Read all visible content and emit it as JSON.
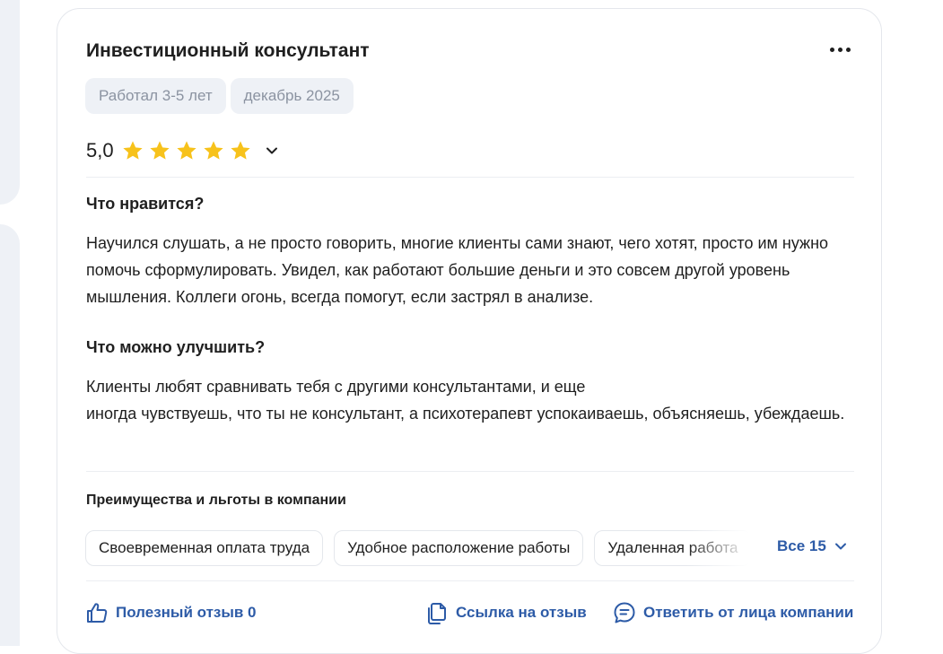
{
  "review": {
    "title": "Инвестиционный консультант",
    "tags": [
      "Работал 3-5 лет",
      "декабрь 2025"
    ],
    "rating": "5,0",
    "stars_filled": 5,
    "stars_total": 5,
    "star_color": "#f7c21b",
    "likes_title": "Что нравится?",
    "likes_text": "Научился слушать, а не просто говорить, многие клиенты сами знают, чего хотят, просто им нужно помочь сформулировать. Увидел, как работают большие деньги и это совсем другой уровень мышления. Коллеги огонь, всегда помогут, если застрял в анализе.",
    "improve_title": "Что можно улучшить?",
    "improve_text": "Клиенты любят сравнивать тебя с другими консультантами, и еще\nиногда чувствуешь, что ты не консультант, а психотерапевт успокаиваешь, объясняешь, убеждаешь."
  },
  "benefits": {
    "title": "Преимущества и льготы в компании",
    "items": [
      "Своевременная оплата труда",
      "Удобное расположение работы",
      "Удаленная работа"
    ],
    "all_label": "Все 15"
  },
  "actions": {
    "helpful": "Полезный отзыв 0",
    "link": "Ссылка на отзыв",
    "reply": "Ответить от лица компании"
  },
  "colors": {
    "accent": "#2d5ba7",
    "chip_bg": "#eef1f6",
    "chip_text": "#8b93a1"
  }
}
